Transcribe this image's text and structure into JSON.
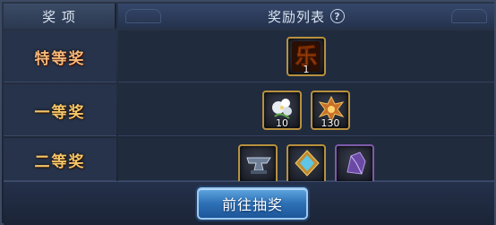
{
  "header": {
    "col_prize": "奖 项",
    "col_rewards": "奖励列表",
    "help_glyph": "?"
  },
  "prizes": [
    {
      "label": "特等奖",
      "items": [
        {
          "icon": "le-character-icon",
          "count": "1"
        }
      ]
    },
    {
      "label": "一等奖",
      "items": [
        {
          "icon": "white-flower-icon",
          "count": "10"
        },
        {
          "icon": "golden-winged-emblem-icon",
          "count": "130"
        }
      ]
    },
    {
      "label": "二等奖",
      "items": [
        {
          "icon": "anvil-icon",
          "count": ""
        },
        {
          "icon": "mirror-frame-icon",
          "count": ""
        },
        {
          "icon": "purple-crystal-icon",
          "count": ""
        }
      ]
    }
  ],
  "action": {
    "button_label": "前往抽奖"
  },
  "colors": {
    "accent_blue": "#2d70b5",
    "label_gold": "#f4c56a",
    "panel_bg": "#1f2839"
  }
}
